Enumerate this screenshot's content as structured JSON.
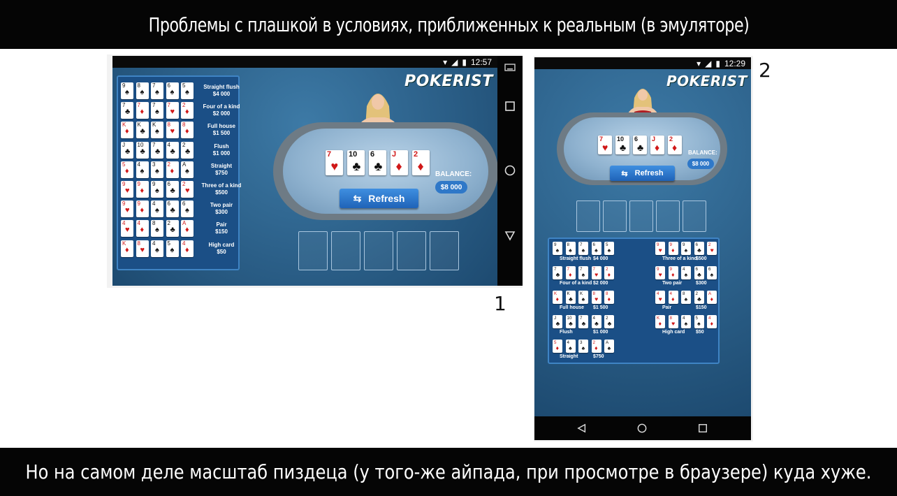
{
  "caption_top": "Проблемы с плашкой в условиях, приближенных к реальным (в эмуляторе)",
  "caption_bottom": "Но на самом деле масштаб пиздеца (у того-же айпада, при просмотре в браузере) куда хуже.",
  "label_1": "1",
  "label_2": "2",
  "shot1": {
    "time": "12:57"
  },
  "shot2": {
    "time": "12:29"
  },
  "game": {
    "logo": "POKERIST",
    "balance_label": "BALANCE:",
    "balance_value": "$8 000",
    "refresh_label": "Refresh",
    "hand": [
      {
        "rank": "7",
        "suit": "♥",
        "red": true
      },
      {
        "rank": "10",
        "suit": "♣",
        "red": false
      },
      {
        "rank": "6",
        "suit": "♣",
        "red": false
      },
      {
        "rank": "J",
        "suit": "♦",
        "red": true
      },
      {
        "rank": "2",
        "suit": "♦",
        "red": true
      }
    ]
  },
  "paytable": [
    {
      "name": "Straight flush",
      "payout": "$4 000"
    },
    {
      "name": "Four of a kind",
      "payout": "$2 000"
    },
    {
      "name": "Full house",
      "payout": "$1 500"
    },
    {
      "name": "Flush",
      "payout": "$1 000"
    },
    {
      "name": "Straight",
      "payout": "$750"
    },
    {
      "name": "Three of a kind",
      "payout": "$500"
    },
    {
      "name": "Two pair",
      "payout": "$300"
    },
    {
      "name": "Pair",
      "payout": "$150"
    },
    {
      "name": "High card",
      "payout": "$50"
    }
  ],
  "colors": {
    "felt_bg": "#2b5f88",
    "panel": "#1b4f86",
    "button": "#2f78c8"
  },
  "icons": {
    "nav1": [
      "keyboard-icon",
      "square-icon",
      "circle-icon",
      "back-triangle-icon"
    ],
    "nav2": [
      "back-triangle-icon",
      "circle-icon",
      "square-icon"
    ]
  }
}
